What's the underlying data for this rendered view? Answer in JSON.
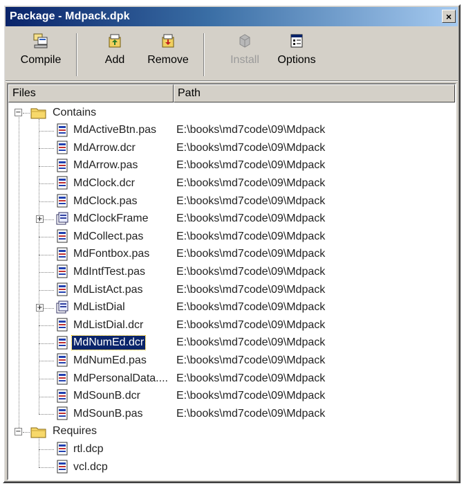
{
  "window": {
    "title": "Package - Mdpack.dpk",
    "close_glyph": "×"
  },
  "toolbar": {
    "buttons": [
      {
        "label": "Compile",
        "icon": "compile-icon",
        "enabled": true
      },
      {
        "label": "Add",
        "icon": "add-icon",
        "enabled": true
      },
      {
        "label": "Remove",
        "icon": "remove-icon",
        "enabled": true
      },
      {
        "label": "Install",
        "icon": "install-icon",
        "enabled": false
      },
      {
        "label": "Options",
        "icon": "options-icon",
        "enabled": true
      }
    ]
  },
  "columns": {
    "files": "Files",
    "path": "Path"
  },
  "tree": {
    "contains": {
      "label": "Contains",
      "expanded": true,
      "items": [
        {
          "name": "MdActiveBtn.pas",
          "path": "E:\\books\\md7code\\09\\Mdpack",
          "type": "file"
        },
        {
          "name": "MdArrow.dcr",
          "path": "E:\\books\\md7code\\09\\Mdpack",
          "type": "file"
        },
        {
          "name": "MdArrow.pas",
          "path": "E:\\books\\md7code\\09\\Mdpack",
          "type": "file"
        },
        {
          "name": "MdClock.dcr",
          "path": "E:\\books\\md7code\\09\\Mdpack",
          "type": "file"
        },
        {
          "name": "MdClock.pas",
          "path": "E:\\books\\md7code\\09\\Mdpack",
          "type": "file"
        },
        {
          "name": "MdClockFrame",
          "path": "E:\\books\\md7code\\09\\Mdpack",
          "type": "unit",
          "expandable": true
        },
        {
          "name": "MdCollect.pas",
          "path": "E:\\books\\md7code\\09\\Mdpack",
          "type": "file"
        },
        {
          "name": "MdFontbox.pas",
          "path": "E:\\books\\md7code\\09\\Mdpack",
          "type": "file"
        },
        {
          "name": "MdIntfTest.pas",
          "path": "E:\\books\\md7code\\09\\Mdpack",
          "type": "file"
        },
        {
          "name": "MdListAct.pas",
          "path": "E:\\books\\md7code\\09\\Mdpack",
          "type": "file"
        },
        {
          "name": "MdListDial",
          "path": "E:\\books\\md7code\\09\\Mdpack",
          "type": "unit",
          "expandable": true
        },
        {
          "name": "MdListDial.dcr",
          "path": "E:\\books\\md7code\\09\\Mdpack",
          "type": "file"
        },
        {
          "name": "MdNumEd.dcr",
          "path": "E:\\books\\md7code\\09\\Mdpack",
          "type": "file",
          "selected": true
        },
        {
          "name": "MdNumEd.pas",
          "path": "E:\\books\\md7code\\09\\Mdpack",
          "type": "file"
        },
        {
          "name": "MdPersonalData....",
          "path": "E:\\books\\md7code\\09\\Mdpack",
          "type": "file"
        },
        {
          "name": "MdSounB.dcr",
          "path": "E:\\books\\md7code\\09\\Mdpack",
          "type": "file"
        },
        {
          "name": "MdSounB.pas",
          "path": "E:\\books\\md7code\\09\\Mdpack",
          "type": "file"
        }
      ]
    },
    "requires": {
      "label": "Requires",
      "expanded": true,
      "items": [
        {
          "name": "rtl.dcp",
          "path": "",
          "type": "file"
        },
        {
          "name": "vcl.dcp",
          "path": "",
          "type": "file"
        }
      ]
    },
    "expander_open": "−",
    "expander_closed": "+"
  },
  "colors": {
    "selection": "#0a246a",
    "face": "#d4d0c8",
    "title_start": "#0a246a",
    "title_end": "#a6caf0"
  }
}
